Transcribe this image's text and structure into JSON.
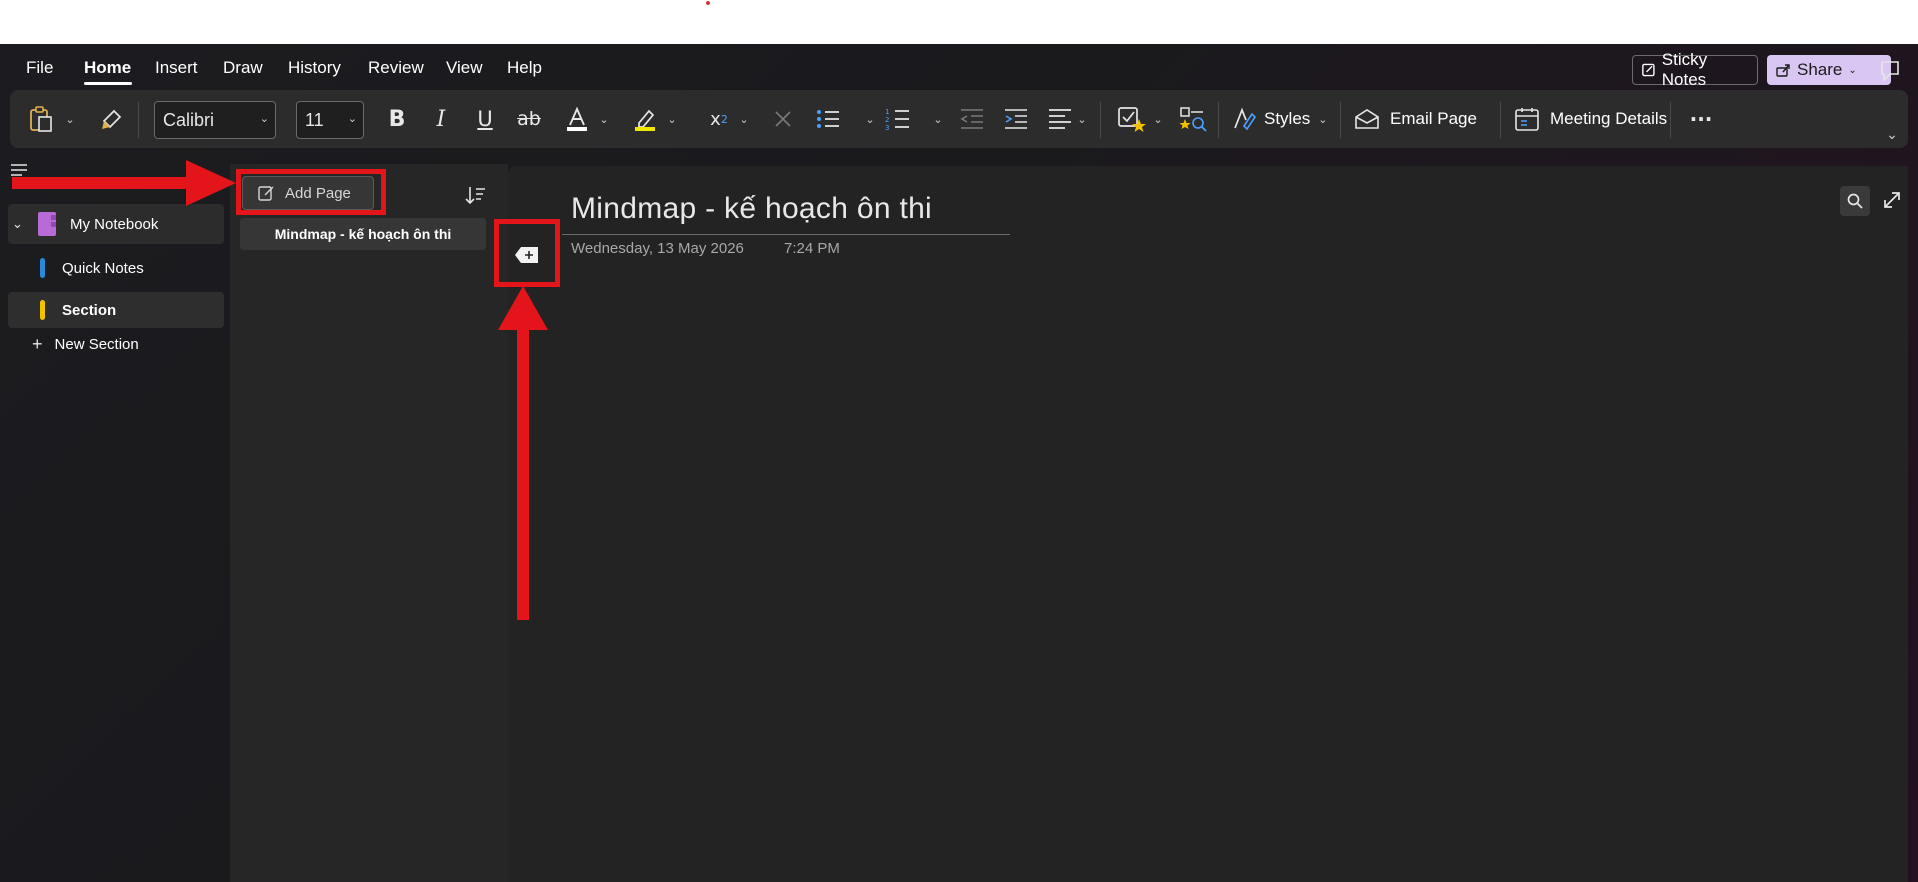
{
  "menubar": {
    "items": [
      {
        "label": "File"
      },
      {
        "label": "Home"
      },
      {
        "label": "Insert"
      },
      {
        "label": "Draw"
      },
      {
        "label": "History"
      },
      {
        "label": "Review"
      },
      {
        "label": "View"
      },
      {
        "label": "Help"
      }
    ],
    "active": "Home",
    "sticky_notes": "Sticky Notes",
    "share": "Share"
  },
  "ribbon": {
    "font_name": "Calibri",
    "font_size": "11",
    "styles_label": "Styles",
    "email_page_label": "Email Page",
    "meeting_details_label": "Meeting Details",
    "more_label": "···"
  },
  "sidebar": {
    "notebook": "My Notebook",
    "notebook_color": "#b86ad6",
    "sections": [
      {
        "label": "Quick Notes",
        "color": "#2b88d8"
      },
      {
        "label": "Section",
        "color": "#f2c100"
      }
    ],
    "new_section": "New Section"
  },
  "pagelist": {
    "add_page": "Add Page",
    "pages": [
      {
        "title": "Mindmap - kế hoạch ôn thi"
      }
    ]
  },
  "page": {
    "title": "Mindmap - kế hoạch ôn thi",
    "date": "Wednesday, 13 May 2026",
    "time": "7:24 PM"
  },
  "colors": {
    "annotation": "#e3151a",
    "share_bg": "#d9c6f2",
    "underline_font_color": "#ffffff",
    "highlight_color": "#f2e600"
  }
}
